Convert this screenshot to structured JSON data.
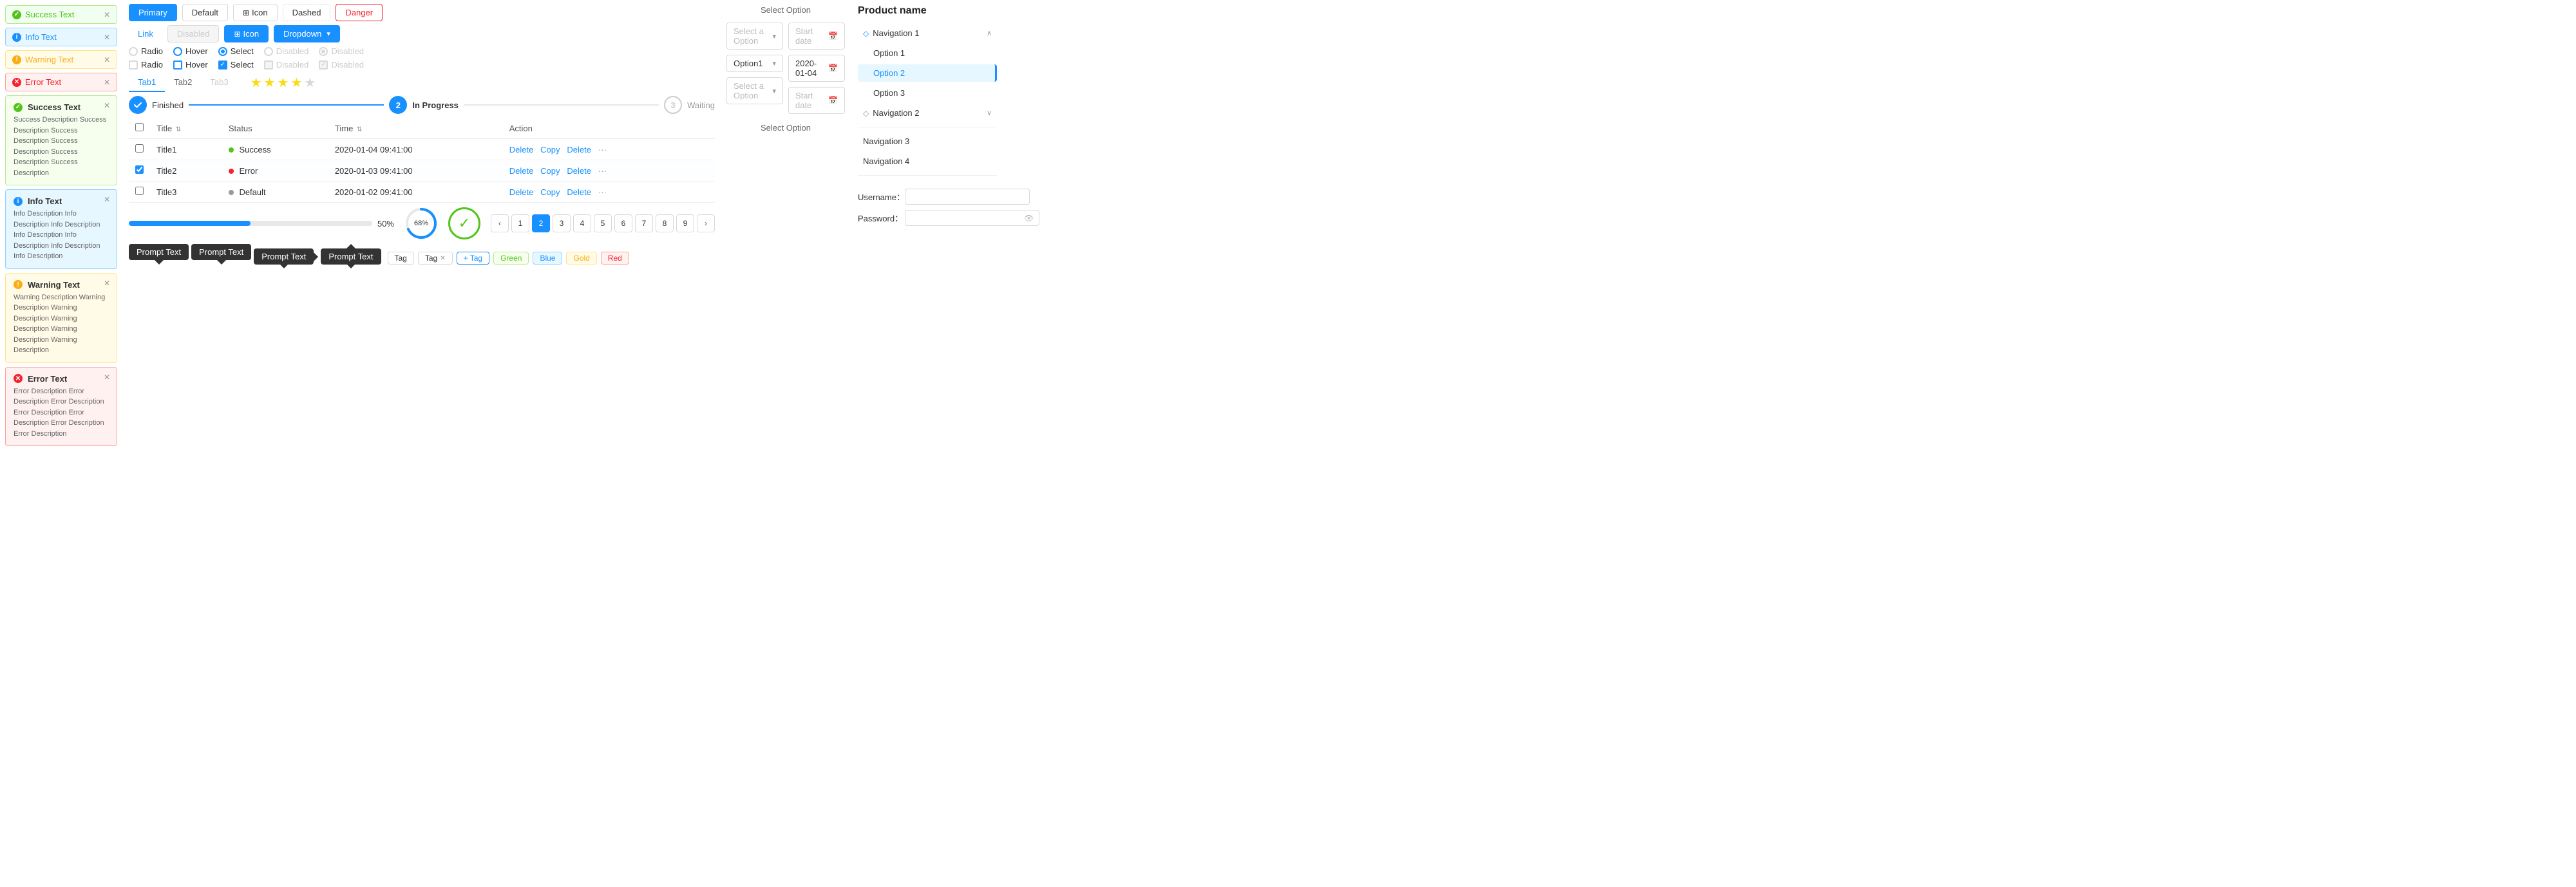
{
  "left_panel": {
    "alerts_simple": [
      {
        "type": "success",
        "text": "Success Text"
      },
      {
        "type": "info",
        "text": "Info Text"
      },
      {
        "type": "warning",
        "text": "Warning Text"
      },
      {
        "type": "error",
        "text": "Error Text"
      }
    ],
    "alerts_banner": [
      {
        "type": "success",
        "title": "Success Text",
        "desc": "Success Description Success Description Success Description Success Description Success Description Success Description"
      },
      {
        "type": "info",
        "title": "Info Text",
        "desc": "Info Description Info Description Info Description Info Description Info Description Info Description Info Description"
      },
      {
        "type": "warning",
        "title": "Warning Text",
        "desc": "Warning Description Warning Description Warning Description Warning Description Warning Description Warning Description"
      },
      {
        "type": "error",
        "title": "Error Text",
        "desc": "Error Description Error Description Error Description Error Description Error Description Error Description Error Description"
      }
    ]
  },
  "buttons": {
    "row1": [
      {
        "label": "Primary",
        "style": "primary"
      },
      {
        "label": "Default",
        "style": "default"
      },
      {
        "label": "Icon",
        "style": "icon",
        "has_icon": true
      },
      {
        "label": "Dashed",
        "style": "dashed"
      },
      {
        "label": "Danger",
        "style": "danger"
      }
    ],
    "row2": [
      {
        "label": "Link",
        "style": "link"
      },
      {
        "label": "Disabled",
        "style": "disabled"
      },
      {
        "label": "Icon",
        "style": "icon-blue",
        "has_icon": true
      },
      {
        "label": "Dropdown",
        "style": "dropdown",
        "has_arrow": true
      }
    ]
  },
  "radios_row1": [
    {
      "label": "Radio",
      "state": "unchecked"
    },
    {
      "label": "Hover",
      "state": "hover"
    },
    {
      "label": "Select",
      "state": "selected"
    },
    {
      "label": "Disabled",
      "state": "disabled"
    },
    {
      "label": "Disabled",
      "state": "disabled-selected"
    }
  ],
  "radios_row2": [
    {
      "label": "Radio",
      "state": "unchecked"
    },
    {
      "label": "Hover",
      "state": "hover-cb"
    },
    {
      "label": "Select",
      "state": "selected-cb"
    },
    {
      "label": "Disabled",
      "state": "disabled-cb"
    },
    {
      "label": "Disabled",
      "state": "disabled-cb-selected"
    }
  ],
  "tabs": [
    {
      "label": "Tab1",
      "active": true
    },
    {
      "label": "Tab2",
      "active": false
    },
    {
      "label": "Tab3",
      "active": false,
      "disabled": true
    }
  ],
  "stars": {
    "filled": 3,
    "half": true,
    "empty": 1,
    "total": 5
  },
  "steps": [
    {
      "label": "Finished",
      "state": "done",
      "num": null
    },
    {
      "label": "In Progress",
      "state": "active",
      "num": "2"
    },
    {
      "label": "Waiting",
      "state": "waiting",
      "num": "3"
    }
  ],
  "table": {
    "columns": [
      "Title",
      "Status",
      "Time",
      "Action"
    ],
    "rows": [
      {
        "checked": false,
        "title": "Title1",
        "status": "Success",
        "status_type": "success",
        "time": "2020-01-04  09:41:00",
        "actions": [
          "Delete",
          "Copy",
          "Delete"
        ]
      },
      {
        "checked": true,
        "title": "Title2",
        "status": "Error",
        "status_type": "error",
        "time": "2020-01-03  09:41:00",
        "actions": [
          "Delete",
          "Copy",
          "Delete"
        ]
      },
      {
        "checked": false,
        "title": "Title3",
        "status": "Default",
        "status_type": "default",
        "time": "2020-01-02  09:41:00",
        "actions": [
          "Delete",
          "Copy",
          "Delete"
        ]
      }
    ]
  },
  "progress": {
    "bar_percent": 50,
    "bar_label": "50%",
    "circle_percent": 68,
    "circle_label": "68%"
  },
  "pagination": {
    "current": 2,
    "pages": [
      1,
      2,
      3,
      4,
      5,
      6,
      7,
      8,
      9
    ]
  },
  "tooltips": [
    {
      "label": "Prompt Text",
      "arrow": "up"
    },
    {
      "label": "Prompt Text",
      "arrow": "up"
    },
    {
      "label": "Prompt Text",
      "arrow": "left"
    },
    {
      "label": "Prompt Text",
      "arrow": "down"
    }
  ],
  "tags": {
    "items": [
      {
        "label": "Tag",
        "closable": false
      },
      {
        "label": "Tag",
        "closable": true
      }
    ],
    "add_label": "+ Tag",
    "colored": [
      {
        "label": "Green",
        "color": "green"
      },
      {
        "label": "Blue",
        "color": "blue"
      },
      {
        "label": "Gold",
        "color": "gold"
      },
      {
        "label": "Red",
        "color": "red"
      }
    ]
  },
  "selects": [
    {
      "placeholder": "Select a Option",
      "value": null
    },
    {
      "placeholder": null,
      "value": "Option1"
    },
    {
      "placeholder": "Select a Option",
      "value": null
    }
  ],
  "dates": [
    {
      "placeholder": "Start date",
      "value": null
    },
    {
      "placeholder": null,
      "value": "2020-01-04"
    },
    {
      "placeholder": "Start date",
      "value": null
    }
  ],
  "right_selects_header": "Select Option",
  "navigation": {
    "title": "Product name",
    "items": [
      {
        "label": "Navigation 1",
        "has_diamond": true,
        "expanded": true,
        "sub_items": [
          {
            "label": "Option 1",
            "active": false
          },
          {
            "label": "Option 2",
            "active": true
          },
          {
            "label": "Option 3",
            "active": false
          }
        ]
      },
      {
        "label": "Navigation 2",
        "has_diamond": true,
        "expanded": false
      },
      {
        "label": "Navigation 3",
        "has_diamond": false
      },
      {
        "label": "Navigation 4",
        "has_diamond": false
      }
    ],
    "form": {
      "username_label": "Username：",
      "password_label": "Password："
    }
  }
}
